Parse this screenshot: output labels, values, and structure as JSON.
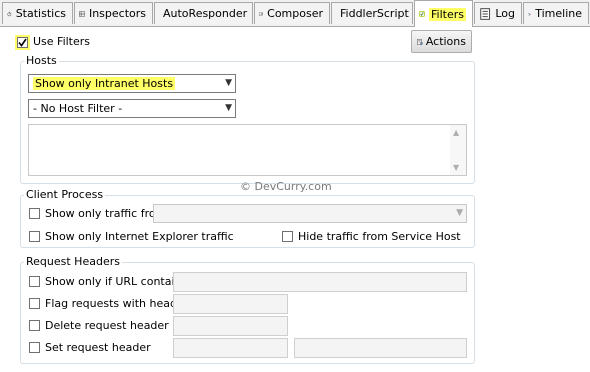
{
  "tabs": [
    {
      "id": "statistics",
      "label": "Statistics",
      "icon": "stopwatch-icon"
    },
    {
      "id": "inspectors",
      "label": "Inspectors",
      "icon": "inspector-grid-icon"
    },
    {
      "id": "autoresponder",
      "label": "AutoResponder",
      "icon": "lightning-icon"
    },
    {
      "id": "composer",
      "label": "Composer",
      "icon": "pencil-icon"
    },
    {
      "id": "fiddlerscript",
      "label": "FiddlerScript",
      "icon": "js-script-icon"
    },
    {
      "id": "filters",
      "label": "Filters",
      "icon": "checkbox-icon",
      "active": true
    },
    {
      "id": "log",
      "label": "Log",
      "icon": "log-page-icon"
    },
    {
      "id": "timeline",
      "label": "Timeline",
      "icon": "timeline-bars-icon"
    }
  ],
  "use_filters": {
    "label": "Use Filters",
    "checked": true
  },
  "actions_button": {
    "label": "Actions",
    "icon": "actions-page-icon"
  },
  "hosts": {
    "title": "Hosts",
    "zone_select": "Show only Intranet Hosts",
    "host_select": "- No Host Filter -",
    "host_list": ""
  },
  "client_process": {
    "title": "Client Process",
    "traffic_from_label": "Show only traffic from",
    "traffic_from_value": "",
    "ie_traffic_label": "Show only Internet Explorer traffic",
    "hide_service_host_label": "Hide traffic from Service Host"
  },
  "request_headers": {
    "title": "Request Headers",
    "url_contains_label": "Show only if URL contains",
    "flag_header_label": "Flag requests with header",
    "delete_header_label": "Delete request header",
    "set_header_label": "Set request header"
  },
  "watermark": "© DevCurry.com",
  "colors": {
    "highlight": "#ffff66",
    "check": "#000000"
  }
}
